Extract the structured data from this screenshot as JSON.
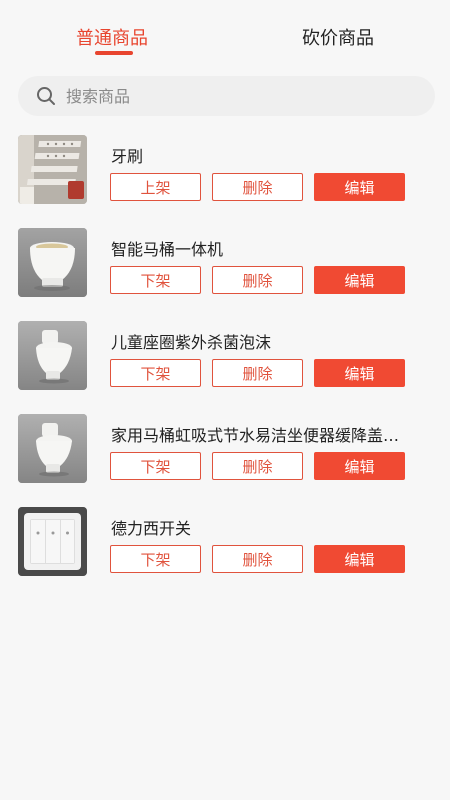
{
  "tabs": [
    {
      "label": "普通商品",
      "active": true
    },
    {
      "label": "砍价商品",
      "active": false
    }
  ],
  "search": {
    "placeholder": "搜索商品",
    "value": ""
  },
  "actions": {
    "delete": "删除",
    "edit": "编辑"
  },
  "products": [
    {
      "name": "牙刷",
      "toggle_label": "上架",
      "image": "bathroom-shelf-product-photo"
    },
    {
      "name": "智能马桶一体机",
      "toggle_label": "下架",
      "image": "smart-toilet-product-photo"
    },
    {
      "name": "儿童座圈紫外杀菌泡沫",
      "toggle_label": "下架",
      "image": "toilet-product-photo"
    },
    {
      "name": "家用马桶虹吸式节水易洁坐便器缓降盖…",
      "toggle_label": "下架",
      "image": "toilet-product-photo"
    },
    {
      "name": "德力西开关",
      "toggle_label": "下架",
      "image": "wall-switch-product-photo"
    }
  ],
  "colors": {
    "accent": "#e8452f",
    "edit_bg": "#f04a33",
    "background": "#f7f7f7"
  }
}
